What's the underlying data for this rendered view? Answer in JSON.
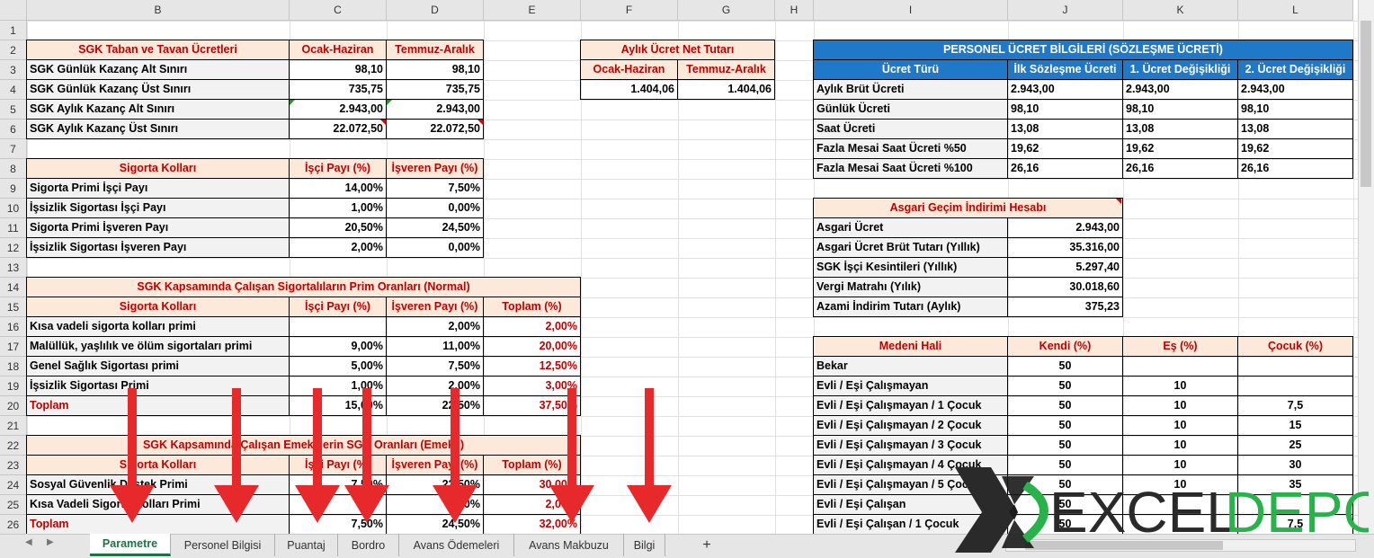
{
  "columns": [
    "B",
    "C",
    "D",
    "E",
    "F",
    "G",
    "H",
    "I",
    "J",
    "K",
    "L"
  ],
  "rows": [
    "1",
    "2",
    "3",
    "4",
    "5",
    "6",
    "7",
    "8",
    "9",
    "10",
    "11",
    "12",
    "13",
    "14",
    "15",
    "16",
    "17",
    "18",
    "19",
    "20",
    "21",
    "22",
    "23",
    "24",
    "25",
    "26"
  ],
  "t1": {
    "title": "SGK Taban ve Tavan Ücretleri",
    "h1": "Ocak-Haziran",
    "h2": "Temmuz-Aralık",
    "rows": [
      [
        "SGK Günlük Kazanç Alt Sınırı",
        "98,10",
        "98,10"
      ],
      [
        "SGK Günlük Kazanç Üst Sınırı",
        "735,75",
        "735,75"
      ],
      [
        "SGK Aylık Kazanç Alt Sınırı",
        "2.943,00",
        "2.943,00"
      ],
      [
        "SGK Aylık Kazanç Üst Sınırı",
        "22.072,50",
        "22.072,50"
      ]
    ]
  },
  "t2": {
    "title": "Sigorta Kolları",
    "h1": "İşçi Payı (%)",
    "h2": "İşveren Payı (%)",
    "rows": [
      [
        "Sigorta Primi İşçi Payı",
        "14,00%",
        "7,50%"
      ],
      [
        "İşsizlik Sigortası İşçi Payı",
        "1,00%",
        "0,00%"
      ],
      [
        "Sigorta Primi İşveren Payı",
        "20,50%",
        "24,50%"
      ],
      [
        "İşsizlik Sigortası İşveren Payı",
        "2,00%",
        "0,00%"
      ]
    ]
  },
  "t3": {
    "caption": "SGK Kapsamında Çalışan Sigortalıların Prim Oranları (Normal)",
    "title": "Sigorta Kolları",
    "h1": "İşçi Payı (%)",
    "h2": "İşveren Payı (%)",
    "h3": "Toplam (%)",
    "rows": [
      [
        "Kısa vadeli sigorta kolları primi",
        "",
        "2,00%",
        "2,00%"
      ],
      [
        "Malüllük, yaşlılık ve ölüm  sigortaları primi",
        "9,00%",
        "11,00%",
        "20,00%"
      ],
      [
        "Genel Sağlık Sigortası primi",
        "5,00%",
        "7,50%",
        "12,50%"
      ],
      [
        "İşsizlik Sigortası Primi",
        "1,00%",
        "2,00%",
        "3,00%"
      ],
      [
        "Toplam",
        "15,00%",
        "22,50%",
        "37,50%"
      ]
    ]
  },
  "t4": {
    "caption": "SGK Kapsamında Çalışan Emeklilerin SGK Oranları (Emekli)",
    "title": "Sigorta Kolları",
    "h1": "İşçi Payı (%)",
    "h2": "İşveren Payı (%)",
    "h3": "Toplam (%)",
    "rows": [
      [
        "Sosyal Güvenlik Destek Primi",
        "7,50%",
        "22,50%",
        "30,00%"
      ],
      [
        "Kısa Vadeli Sigorta Kolları Primi",
        "",
        "2,00%",
        "2,00%"
      ],
      [
        "Toplam",
        "7,50%",
        "24,50%",
        "32,00%"
      ]
    ]
  },
  "t5": {
    "title": "Aylık Ücret Net Tutarı",
    "h1": "Ocak-Haziran",
    "h2": "Temmuz-Aralık",
    "v1": "1.404,06",
    "v2": "1.404,06"
  },
  "t6": {
    "title": "PERSONEL ÜCRET BİLGİLERİ (SÖZLEŞME ÜCRETİ)",
    "h0": "Ücret Türü",
    "h1": "İlk Sözleşme Ücreti",
    "h2": "1. Ücret Değişikliği",
    "h3": "2. Ücret Değişikliği",
    "rows": [
      [
        "Aylık Brüt Ücreti",
        "2.943,00",
        "2.943,00",
        "2.943,00"
      ],
      [
        "Günlük Ücreti",
        "98,10",
        "98,10",
        "98,10"
      ],
      [
        "Saat Ücreti",
        "13,08",
        "13,08",
        "13,08"
      ],
      [
        "Fazla Mesai Saat Ücreti %50",
        "19,62",
        "19,62",
        "19,62"
      ],
      [
        "Fazla Mesai Saat Ücreti %100",
        "26,16",
        "26,16",
        "26,16"
      ]
    ]
  },
  "t7": {
    "title": "Asgari Geçim İndirimi Hesabı",
    "rows": [
      [
        "Asgari Ücret",
        "2.943,00"
      ],
      [
        "Asgari Ücret Brüt Tutarı (Yıllık)",
        "35.316,00"
      ],
      [
        "SGK İşçi Kesintileri (Yıllık)",
        "5.297,40"
      ],
      [
        "Vergi Matrahı (Yılık)",
        "30.018,60"
      ],
      [
        "Azami İndirim Tutarı (Aylık)",
        "375,23"
      ]
    ]
  },
  "t8": {
    "h0": "Medeni Hali",
    "h1": "Kendi (%)",
    "h2": "Eş (%)",
    "h3": "Çocuk (%)",
    "rows": [
      [
        "Bekar",
        "50",
        "",
        ""
      ],
      [
        "Evli / Eşi Çalışmayan",
        "50",
        "10",
        ""
      ],
      [
        "Evli / Eşi Çalışmayan / 1 Çocuk",
        "50",
        "10",
        "7,5"
      ],
      [
        "Evli / Eşi Çalışmayan / 2 Çocuk",
        "50",
        "10",
        "15"
      ],
      [
        "Evli / Eşi Çalışmayan / 3 Çocuk",
        "50",
        "10",
        "25"
      ],
      [
        "Evli / Eşi Çalışmayan / 4 Çocuk",
        "50",
        "10",
        "30"
      ],
      [
        "Evli / Eşi Çalışmayan / 5 Çocuk",
        "50",
        "10",
        "35"
      ],
      [
        "Evli / Eşi Çalışan",
        "50",
        "",
        ""
      ],
      [
        "Evli / Eşi Çalışan / 1 Çocuk",
        "50",
        "",
        "7,5"
      ]
    ]
  },
  "tabs": [
    "Parametre",
    "Personel Bilgisi",
    "Puantaj",
    "Bordro",
    "Avans Ödemeleri",
    "Avans Makbuzu",
    "Bilgi"
  ],
  "add_sheet": "+",
  "logo": {
    "x": "X",
    "text1": "EXCEL",
    "text2": "DEPO"
  },
  "colors": {
    "accent_blue": "#1f78c8",
    "header_pink": "#fde9d9",
    "red_text": "#c00000",
    "arrow_red": "#e8292b",
    "excel_green": "#1e7145"
  }
}
